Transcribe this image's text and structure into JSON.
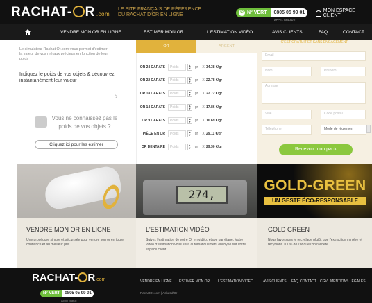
{
  "header": {
    "logo_text": "RACHAT",
    "logo_accent": "R",
    "logo_suffix": ".com",
    "tagline_1": "LE SITE FRANÇAIS DE RÉFÉRENCE",
    "tagline_2": "DU RACHAT D'OR EN LIGNE",
    "phone_badge": "N° VERT",
    "phone_number": "0805 05 99 01",
    "phone_sub": "APPEL GRATUIT",
    "account_label": "MON ESPACE CLIENT"
  },
  "nav": {
    "items": [
      "VENDRE MON OR EN LIGNE",
      "ESTIMER MON OR",
      "L'ESTIMATION VIDÉO",
      "AVIS CLIENTS",
      "FAQ",
      "CONTACT"
    ]
  },
  "simulator": {
    "intro": "Le simulateur Rachat Or.com vous permet d'estimer la valeur de vos métaux précieux en fonction de leur poids",
    "instruction": "Indiquez le poids de vos objets & découvrez instantanément leur valeur",
    "unknown_text": "Vous ne connaissez pas le poids de vos objets ?",
    "estimate_button": "Cliquez ici pour les estimer"
  },
  "tabs": {
    "or": "OR",
    "argent": "ARGENT"
  },
  "rates": [
    {
      "label": "OR 24 CARATS",
      "placeholder": "Poids",
      "unit": "gr",
      "op": "X",
      "price": "34.38 €/gr"
    },
    {
      "label": "OR 22 CARATS",
      "placeholder": "Poids",
      "unit": "gr",
      "op": "X",
      "price": "22.78 €/gr"
    },
    {
      "label": "OR 18 CARATS",
      "placeholder": "Poids",
      "unit": "gr",
      "op": "X",
      "price": "22.72 €/gr"
    },
    {
      "label": "OR 14 CARATS",
      "placeholder": "Poids",
      "unit": "gr",
      "op": "X",
      "price": "17.86 €/gr"
    },
    {
      "label": "OR 9 CARATS",
      "placeholder": "Poids",
      "unit": "gr",
      "op": "X",
      "price": "10.69 €/gr"
    },
    {
      "label": "PIÈCE EN OR",
      "placeholder": "Poids",
      "unit": "gr",
      "op": "X",
      "price": "29.11 €/gr"
    },
    {
      "label": "OR DENTAIRE",
      "placeholder": "Poids",
      "unit": "gr",
      "op": "X",
      "price": "29.30 €/gr"
    }
  ],
  "form": {
    "heading": "C'EST GRATUIT ET SANS ENGAGEMENT",
    "email": "Email",
    "nom": "Nom",
    "prenom": "Prénom",
    "adresse": "Adresse",
    "ville": "Ville",
    "cp": "Code postal",
    "tel": "Téléphone",
    "reglement": "Mode de règlemen",
    "submit": "Recevoir mon pack"
  },
  "promos": [
    {
      "title": "VENDRE MON OR EN LIGNE",
      "text": "Une procédure simple et sécurisée pour vendre son or en toute confiance et au meilleur prix"
    },
    {
      "title": "L'ESTIMATION VIDÉO",
      "text": "Suivez l'estimation de votre Or en vidéo, étape par étape. Votre vidéo d'estimation vous sera automatiquement envoyée sur votre espace client.",
      "display": "274,"
    },
    {
      "title": "GOLD GREEN",
      "text": "Nous favorisons le recyclage plutôt que l'extraction minière et recyclons 100% de l'or que l'on rachète",
      "banner": "GOLD-GREEN",
      "banner_sub": "UN GESTE ÉCO-RESPONSABLE"
    }
  ],
  "footer": {
    "links": [
      "VENDRE EN LIGNE",
      "ESTIMER MON OR",
      "L'ESTIMATION VIDEO",
      "AVIS CLIENTS",
      "FAQ",
      "CONTACT",
      "CGV",
      "MENTIONS LÉGALES"
    ],
    "copyright": "RachatOr.com | Achat d'Or",
    "phone_badge": "N° VERT",
    "phone_number": "0805 05 99 01",
    "phone_sub": "Appel gratuit"
  },
  "colors": {
    "gold": "#e1b23c",
    "green": "#8bc83e",
    "dark": "#111111",
    "cream": "#f6f0e2"
  }
}
